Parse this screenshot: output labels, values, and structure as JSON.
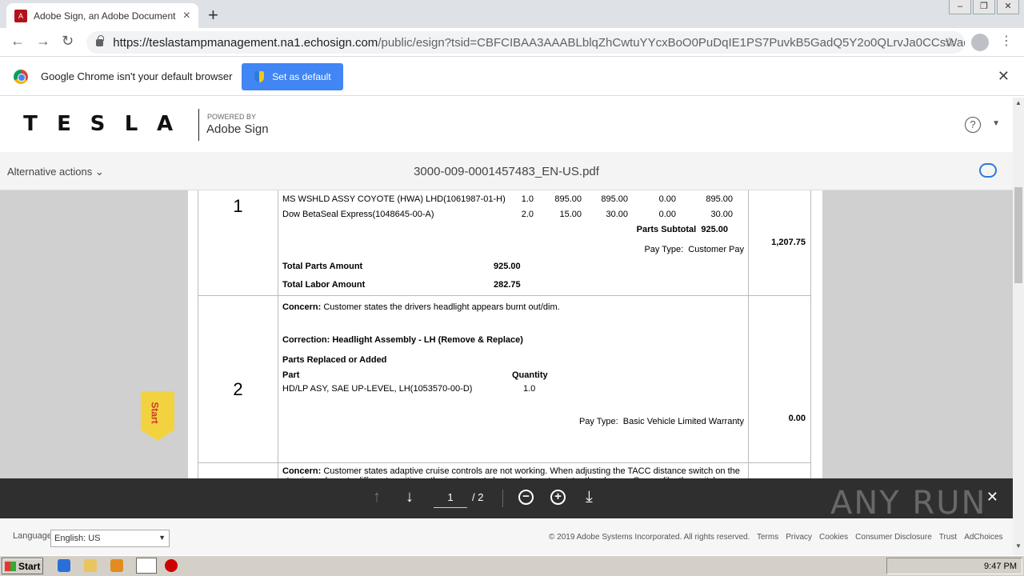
{
  "browser": {
    "tab_title": "Adobe Sign, an Adobe Document Cl",
    "url_host": "https://teslastampmanagement.na1.echosign.com",
    "url_path": "/public/esign?tsid=CBFCIBAA3AAABLblqZhCwtuYYcxBoO0PuDqIE1PS7PuvkB5GadQ5Y2o0QLrvJa0CCsWadncSI5...",
    "infobar_text": "Google Chrome isn't your default browser",
    "set_default_label": "Set as default"
  },
  "header": {
    "brand_letters": [
      "T",
      "E",
      "S",
      "L",
      "A"
    ],
    "powered_by": "POWERED BY",
    "product": "Adobe Sign"
  },
  "docbar": {
    "alt_actions": "Alternative actions",
    "title": "3000-009-0001457483_EN-US.pdf"
  },
  "document": {
    "section1": {
      "number": "1",
      "lines": [
        {
          "desc": "MS WSHLD ASSY COYOTE (HWA) LHD(1061987-01-H)",
          "qty": "1.0",
          "unit": "895.00",
          "ext": "895.00",
          "disc": "0.00",
          "total": "895.00"
        },
        {
          "desc": "Dow BetaSeal Express(1048645-00-A)",
          "qty": "2.0",
          "unit": "15.00",
          "ext": "30.00",
          "disc": "0.00",
          "total": "30.00"
        }
      ],
      "parts_subtotal_label": "Parts Subtotal",
      "parts_subtotal": "925.00",
      "pay_type_label": "Pay Type:",
      "pay_type": "Customer Pay",
      "amount": "1,207.75",
      "total_parts_label": "Total Parts Amount",
      "total_parts": "925.00",
      "total_labor_label": "Total Labor Amount",
      "total_labor": "282.75"
    },
    "section2": {
      "number": "2",
      "concern_label": "Concern:",
      "concern": "Customer states the drivers headlight appears burnt out/dim.",
      "correction": "Correction: Headlight Assembly - LH (Remove & Replace)",
      "parts_heading": "Parts Replaced or Added",
      "part_col": "Part",
      "qty_col": "Quantity",
      "part": "HD/LP ASY, SAE UP-LEVEL, LH(1053570-00-D)",
      "qty": "1.0",
      "pay_type_label": "Pay Type:",
      "pay_type": "Basic Vehicle Limited Warranty",
      "amount": "0.00"
    },
    "section3": {
      "concern_label": "Concern:",
      "concern": "Customer states adaptive cruise controls are not working. When adjusting the TACC distance switch on the steering column to different positions, the instrument cluster does not register the change. Seems like the switch may be"
    }
  },
  "start_flag": "Start",
  "pager": {
    "current_page": "1",
    "total_pages": "/ 2",
    "watermark": "ANY RUN"
  },
  "footer": {
    "language_label": "Language",
    "language_value": "English: US",
    "copyright": "© 2019 Adobe Systems Incorporated. All rights reserved.",
    "links": [
      "Terms",
      "Privacy",
      "Cookies",
      "Consumer Disclosure",
      "Trust",
      "AdChoices"
    ]
  },
  "taskbar": {
    "start_label": "Start",
    "clock": "9:47 PM"
  },
  "colors": {
    "accent_blue": "#4285f4",
    "pager_bg": "#2f2f2f",
    "start_flag": "#f2d33f"
  }
}
